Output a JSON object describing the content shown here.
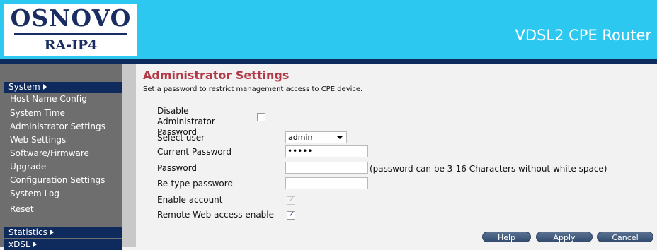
{
  "header": {
    "logo_brand": "OSNOVO",
    "logo_model": "RA-IP4",
    "product_title": "VDSL2 CPE Router"
  },
  "sidebar": {
    "sections": [
      {
        "label": "System"
      },
      {
        "label": "Statistics"
      },
      {
        "label": "xDSL"
      }
    ],
    "items": [
      {
        "label": "Host Name Config"
      },
      {
        "label": "System Time"
      },
      {
        "label": "Administrator Settings"
      },
      {
        "label": "Web Settings"
      },
      {
        "label": "Software/Firmware"
      },
      {
        "label": "Upgrade"
      },
      {
        "label": "Configuration Settings"
      },
      {
        "label": "System Log"
      },
      {
        "label": "Reset"
      }
    ]
  },
  "main": {
    "title": "Administrator Settings",
    "description": "Set a password to restrict management access to CPE device.",
    "form": {
      "disable_admin_label": "Disable Administrator Password",
      "disable_admin_checked": false,
      "select_user_label": "Select user",
      "select_user_value": "admin",
      "current_password_label": "Current Password",
      "current_password_value": "•••••",
      "password_label": "Password",
      "password_value": "",
      "password_hint": "(password can be 3-16 Characters without white space)",
      "retype_password_label": "Re-type password",
      "retype_password_value": "",
      "enable_account_label": "Enable account",
      "enable_account_checked": true,
      "remote_web_label": "Remote Web access enable",
      "remote_web_checked": true
    },
    "buttons": {
      "help": "Help",
      "apply": "Apply",
      "cancel": "Cancel"
    }
  },
  "icons": {
    "section_arrow": "triangle-right-icon",
    "select_caret": "caret-down-icon",
    "checkmark": "check-icon"
  }
}
